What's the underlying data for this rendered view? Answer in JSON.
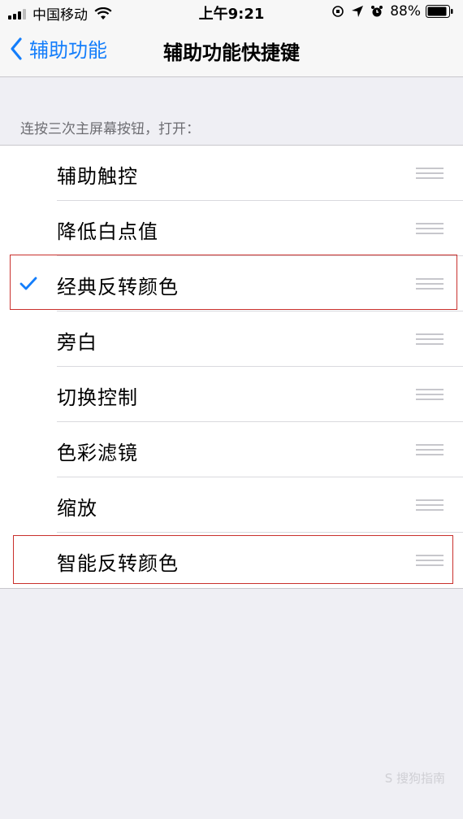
{
  "status_bar": {
    "carrier": "中国移动",
    "time": "上午9:21",
    "battery": "88%"
  },
  "nav": {
    "back_label": "辅助功能",
    "title": "辅助功能快捷键"
  },
  "section": {
    "header": "连按三次主屏幕按钮，打开："
  },
  "items": [
    {
      "label": "辅助触控",
      "checked": false
    },
    {
      "label": "降低白点值",
      "checked": false
    },
    {
      "label": "经典反转颜色",
      "checked": true
    },
    {
      "label": "旁白",
      "checked": false
    },
    {
      "label": "切换控制",
      "checked": false
    },
    {
      "label": "色彩滤镜",
      "checked": false
    },
    {
      "label": "缩放",
      "checked": false
    },
    {
      "label": "智能反转颜色",
      "checked": false
    }
  ],
  "watermark": "S 搜狗指南",
  "colors": {
    "accent": "#147efb",
    "highlight": "#c9302c",
    "background": "#efeff4"
  }
}
